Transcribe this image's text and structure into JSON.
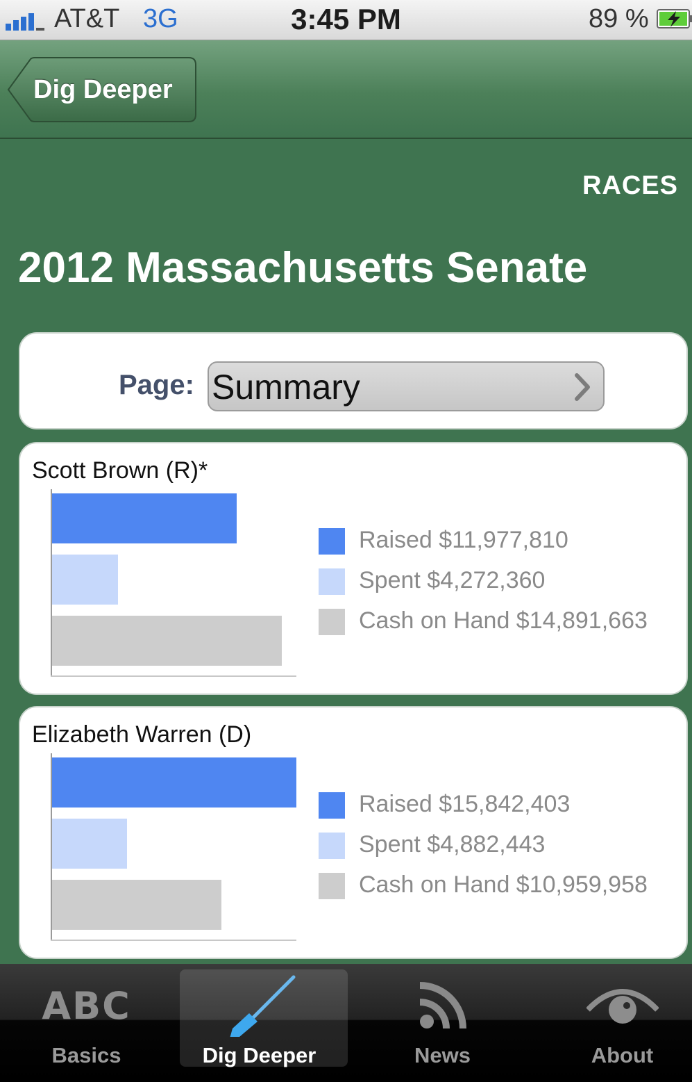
{
  "status_bar": {
    "carrier": "AT&T",
    "network": "3G",
    "time": "3:45 PM",
    "battery": "89 %"
  },
  "nav": {
    "back_label": "Dig Deeper"
  },
  "header": {
    "races_link": "RACES",
    "title": "2012 Massachusetts Senate"
  },
  "page_selector": {
    "label": "Page:",
    "value": "Summary"
  },
  "colors": {
    "raised": "#4f86f1",
    "spent": "#c6d8fb",
    "cash_on_hand": "#cdcdcd",
    "brand_green": "#3f7450"
  },
  "candidates": [
    {
      "name": "Scott Brown (R)*",
      "legend": [
        "Raised $11,977,810",
        "Spent $4,272,360",
        "Cash on Hand $14,891,663"
      ],
      "values": {
        "raised": 11977810,
        "spent": 4272360,
        "cash_on_hand": 14891663
      }
    },
    {
      "name": "Elizabeth Warren (D)",
      "legend": [
        "Raised $15,842,403",
        "Spent $4,882,443",
        "Cash on Hand $10,959,958"
      ],
      "values": {
        "raised": 15842403,
        "spent": 4882443,
        "cash_on_hand": 10959958
      }
    }
  ],
  "tabs": [
    {
      "label": "Basics",
      "icon": "abc-icon",
      "icon_text": "ABC"
    },
    {
      "label": "Dig Deeper",
      "icon": "shovel-icon"
    },
    {
      "label": "News",
      "icon": "rss-icon"
    },
    {
      "label": "About",
      "icon": "eye-icon"
    }
  ]
}
